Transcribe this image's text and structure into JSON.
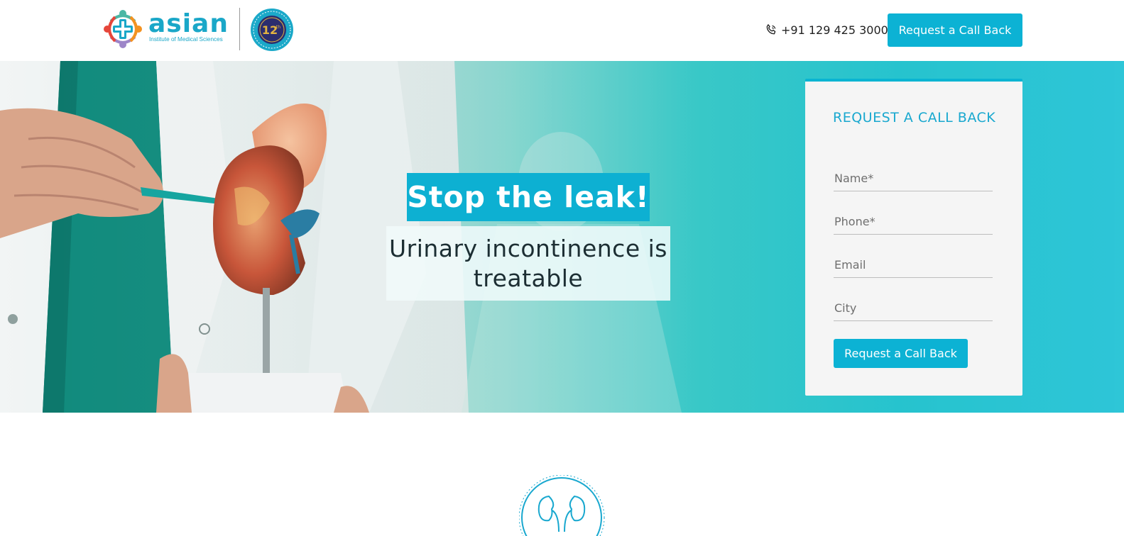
{
  "header": {
    "logo_word": "asian",
    "logo_subtitle": "Institute of Medical Sciences",
    "seal_number": "12",
    "seal_suffix": "th",
    "phone_number": "+91 129 425 3000",
    "cta_label": "Request a Call Back"
  },
  "hero": {
    "headline": "Stop the leak!",
    "subhead": "Urinary incontinence is treatable"
  },
  "form": {
    "title": "REQUEST A CALL BACK",
    "fields": {
      "name_placeholder": "Name*",
      "phone_placeholder": "Phone*",
      "email_placeholder": "Email",
      "city_placeholder": "City"
    },
    "submit_label": "Request a Call Back"
  },
  "colors": {
    "brand": "#0cb2d4",
    "form_title": "#19a8cf",
    "hero_gradient_end": "#00b9cf"
  },
  "icons": {
    "phone": "phone-icon",
    "logo": "cross-logo-icon",
    "seal": "anniversary-seal-icon",
    "emblem": "kidney-emblem-icon"
  }
}
